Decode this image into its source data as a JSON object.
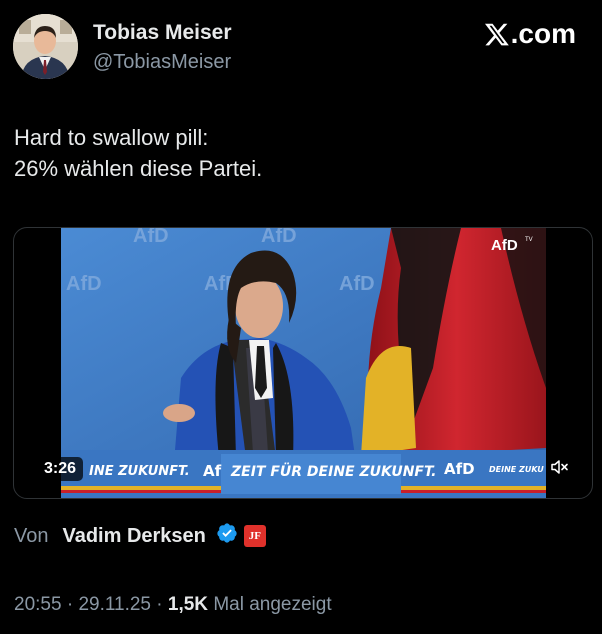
{
  "author": {
    "display_name": "Tobias Meiser",
    "handle": "@TobiasMeiser",
    "avatar_icon": "profile-photo"
  },
  "site": {
    "logo_text": ".com",
    "logo_icon": "x-logo-icon"
  },
  "tweet": {
    "line1": "Hard to swallow pill:",
    "line2": "26% wählen diese Partei."
  },
  "video": {
    "duration": "3:26",
    "mute_icon": "volume-muted-icon",
    "banner_text_left": "INE ZUKUNFT.",
    "banner_text_main": "ZEIT FÜR DEINE ZUKUNFT.",
    "banner_text_right": "DEINE ZUKU",
    "banner_logo_left": "Af",
    "banner_logo_right": "AfD",
    "corner_logo": "AfD",
    "corner_logo_sup": "TV",
    "wall_logos": [
      "AfD",
      "AfD",
      "AfD",
      "AfD",
      "AfD"
    ],
    "colors": {
      "wall": "#3f7bc4",
      "banner": "#3a76c2",
      "flag_black": "#111111",
      "flag_red": "#c8202a",
      "flag_gold": "#e3b227"
    }
  },
  "attribution": {
    "from_label": "Von",
    "source_name": "Vadim Derksen",
    "verified_icon": "verified-badge-icon",
    "badge_text": "JF"
  },
  "meta": {
    "time": "20:55",
    "date": "29.11.25",
    "views_count": "1,5K",
    "views_label": "Mal angezeigt",
    "separator": "·"
  },
  "colors": {
    "background": "#000000",
    "text_primary": "#e7e9ea",
    "text_secondary": "#8b98a5",
    "verified_blue": "#1d9bf0",
    "badge_red": "#e0312b"
  }
}
